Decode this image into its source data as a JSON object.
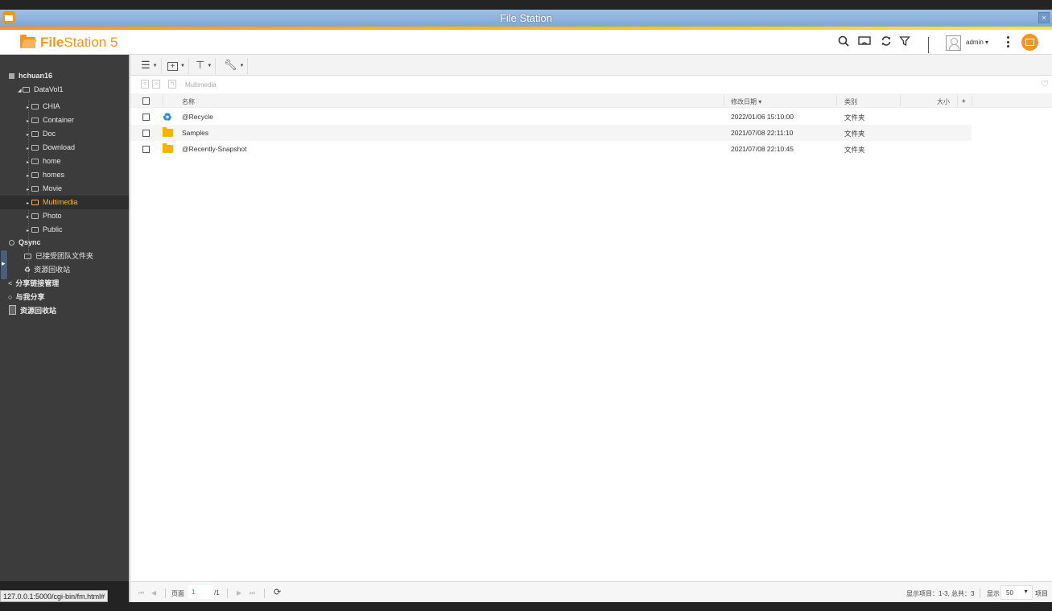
{
  "window": {
    "title": "File Station",
    "close_label": "×"
  },
  "header": {
    "logo_bold": "File",
    "logo_rest": "Station 5",
    "user_name": "admin",
    "icons": [
      "search-icon",
      "media-cast-icon",
      "refresh-icon",
      "filter-icon",
      "more-icon",
      "background-task-icon"
    ]
  },
  "sidebar": {
    "host": "hchuan16",
    "volume": "DataVol1",
    "folders": [
      {
        "label": "CHIA",
        "selected": false
      },
      {
        "label": "Container",
        "selected": false
      },
      {
        "label": "Doc",
        "selected": false
      },
      {
        "label": "Download",
        "selected": false
      },
      {
        "label": "home",
        "selected": false
      },
      {
        "label": "homes",
        "selected": false
      },
      {
        "label": "Movie",
        "selected": false
      },
      {
        "label": "Multimedia",
        "selected": true
      },
      {
        "label": "Photo",
        "selected": false
      },
      {
        "label": "Public",
        "selected": false
      }
    ],
    "qsync": "Qsync",
    "qsync_items": [
      "已接受团队文件夹",
      "资源回收站"
    ],
    "share_link": "分享链接管理",
    "shared_with_me": "与我分享",
    "recycle_bin": "资源回收站"
  },
  "path": {
    "current": "Multimedia"
  },
  "table": {
    "columns": {
      "name": "名称",
      "modified": "修改日期",
      "type": "类别",
      "size": "大小",
      "add": "+"
    },
    "rows": [
      {
        "name": "@Recycle",
        "icon": "recycle-icon",
        "modified": "2022/01/06 15:10:00",
        "type": "文件夹",
        "size": ""
      },
      {
        "name": "Samples",
        "icon": "folder-icon",
        "modified": "2021/07/08 22:11:10",
        "type": "文件夹",
        "size": ""
      },
      {
        "name": "@Recently-Snapshot",
        "icon": "folder-icon",
        "modified": "2021/07/08 22:10:45",
        "type": "文件夹",
        "size": ""
      }
    ]
  },
  "footer": {
    "page_label": "页面",
    "page_value": "1",
    "page_total": "/1",
    "display_info": "显示项目：1-3, 总共：3",
    "show_label": "显示",
    "per_page": "50",
    "items_label": "项目"
  },
  "status_url": "127.0.0.1:5000/cgi-bin/fm.html#"
}
